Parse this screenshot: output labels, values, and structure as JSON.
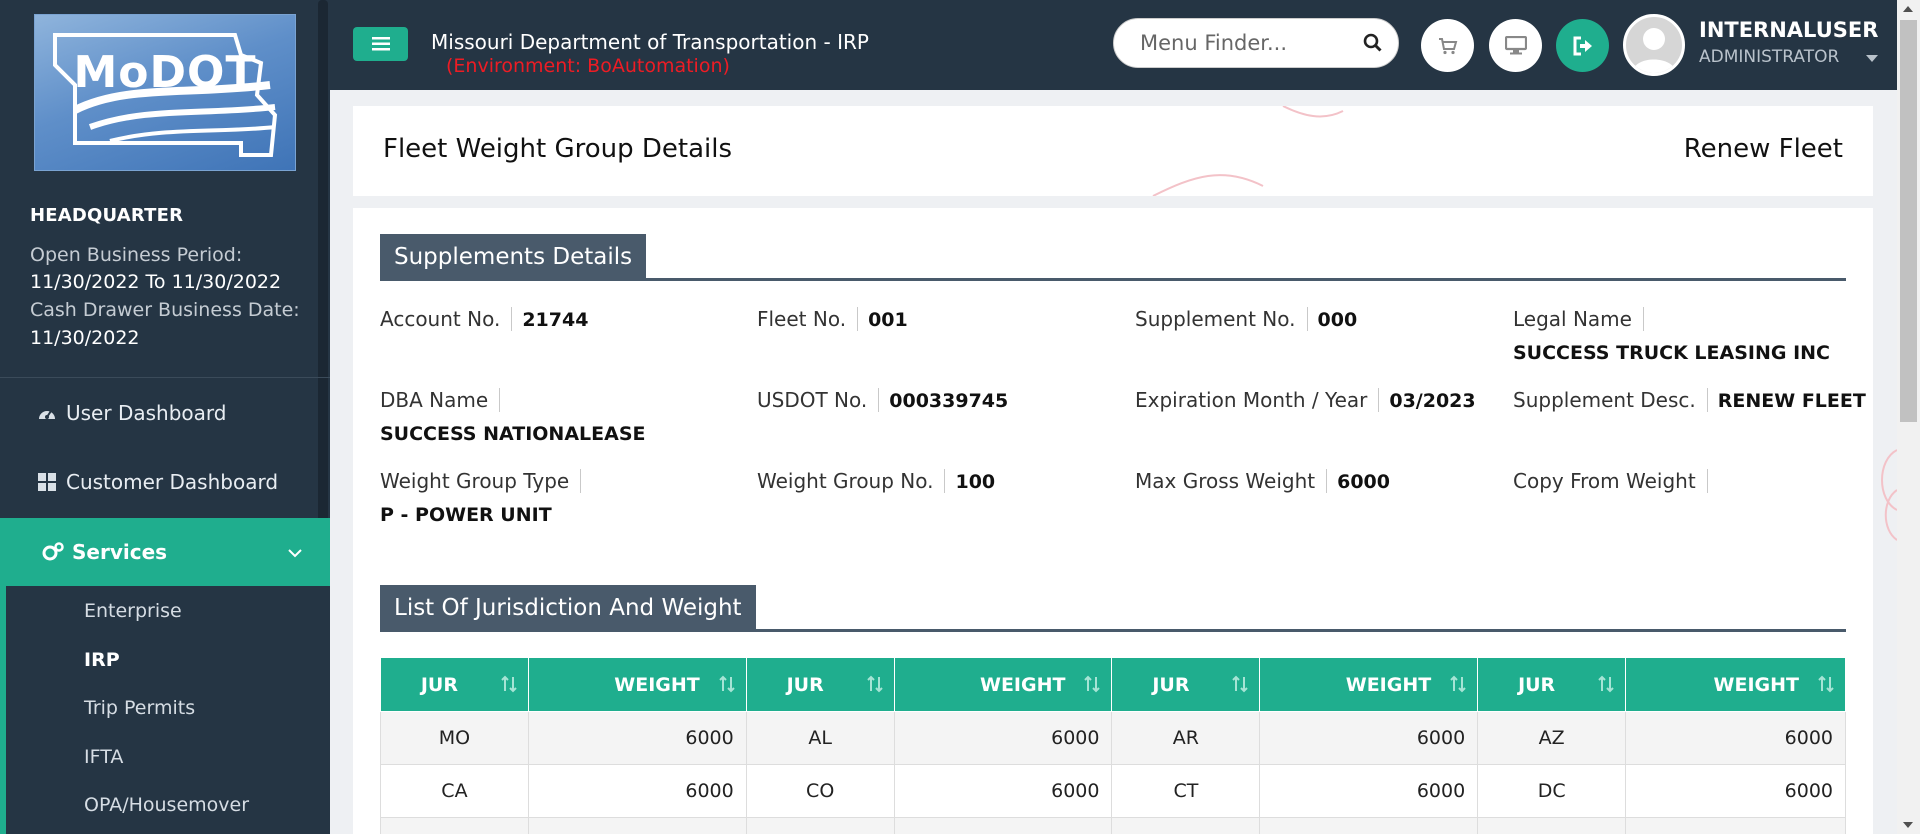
{
  "sidebar": {
    "logo_text": "MoDOT",
    "office": "HEADQUARTER",
    "open_period_label": "Open Business Period:",
    "open_period_value": "11/30/2022 To 11/30/2022",
    "cash_drawer_label": "Cash Drawer Business Date:",
    "cash_drawer_value": "11/30/2022",
    "nav": [
      {
        "label": "User Dashboard",
        "icon": "dashboard-icon"
      },
      {
        "label": "Customer Dashboard",
        "icon": "grid-icon"
      },
      {
        "label": "Services",
        "icon": "gears-icon",
        "expanded": true
      }
    ],
    "sub_items": [
      "Enterprise",
      "IRP",
      "Trip Permits",
      "IFTA",
      "OPA/Housemover"
    ],
    "current_sub": "IRP"
  },
  "header": {
    "app_title": "Missouri Department of Transportation - IRP",
    "environment": "(Environment: BoAutomation)",
    "menu_finder_placeholder": "Menu Finder...",
    "user_name": "INTERNALUSER",
    "user_role": "ADMINISTRATOR",
    "icons": [
      "cart-icon",
      "monitor-icon",
      "logout-icon"
    ]
  },
  "page": {
    "title": "Fleet Weight Group Details",
    "action": "Renew Fleet"
  },
  "supplements": {
    "heading": "Supplements Details",
    "fields": {
      "account_no": {
        "label": "Account No.",
        "value": "21744"
      },
      "fleet_no": {
        "label": "Fleet No.",
        "value": "001"
      },
      "supplement_no": {
        "label": "Supplement No.",
        "value": "000"
      },
      "legal_name": {
        "label": "Legal Name",
        "value": "SUCCESS TRUCK LEASING INC"
      },
      "dba_name": {
        "label": "DBA Name",
        "value": "SUCCESS NATIONALEASE"
      },
      "usdot_no": {
        "label": "USDOT No.",
        "value": "000339745"
      },
      "expiration": {
        "label": "Expiration Month / Year",
        "value": "03/2023"
      },
      "supplement_desc": {
        "label": "Supplement Desc.",
        "value": "RENEW FLEET"
      },
      "weight_group_type": {
        "label": "Weight Group Type",
        "value": "P - POWER UNIT"
      },
      "weight_group_no": {
        "label": "Weight Group No.",
        "value": "100"
      },
      "max_gross_weight": {
        "label": "Max Gross Weight",
        "value": "6000"
      },
      "copy_from_weight": {
        "label": "Copy From Weight",
        "value": ""
      }
    }
  },
  "jurisdictions": {
    "heading": "List Of Jurisdiction And Weight",
    "columns": [
      "JUR",
      "WEIGHT",
      "JUR",
      "WEIGHT",
      "JUR",
      "WEIGHT",
      "JUR",
      "WEIGHT"
    ],
    "rows": [
      [
        "MO",
        "6000",
        "AL",
        "6000",
        "AR",
        "6000",
        "AZ",
        "6000"
      ],
      [
        "CA",
        "6000",
        "CO",
        "6000",
        "CT",
        "6000",
        "DC",
        "6000"
      ]
    ]
  }
}
